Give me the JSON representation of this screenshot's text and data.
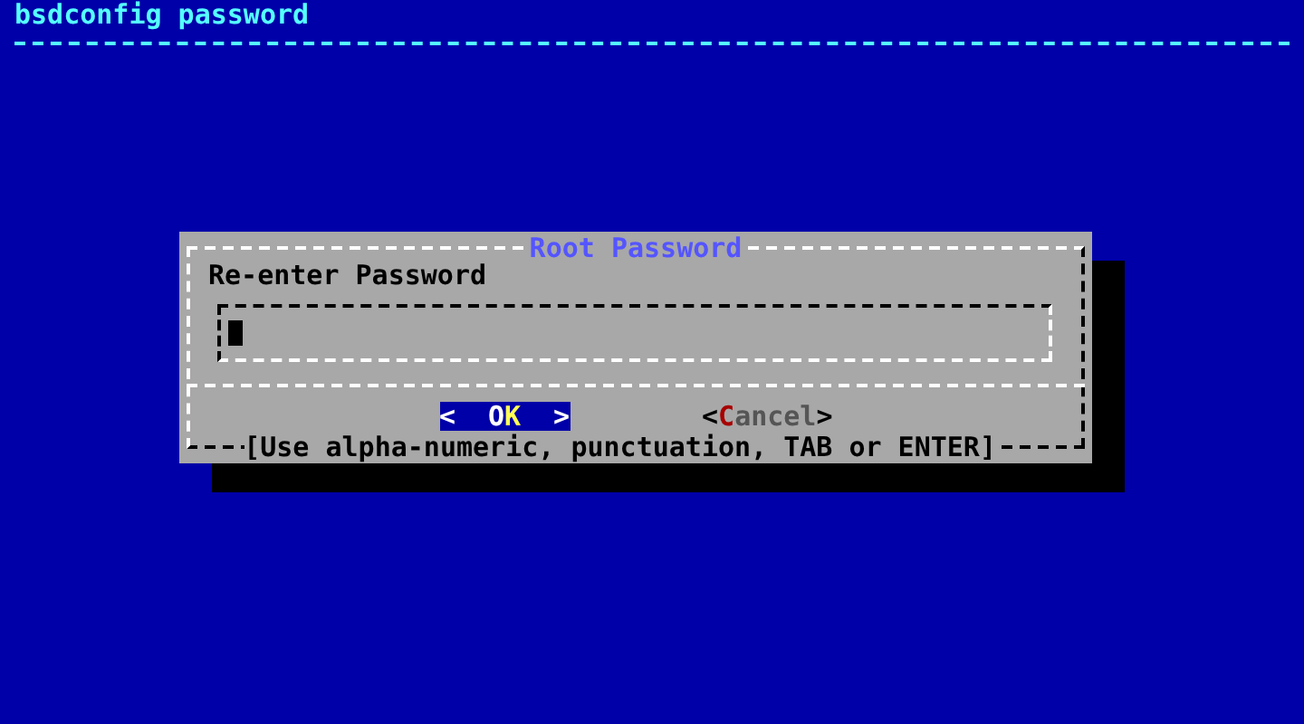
{
  "screen_title": "bsdconfig password",
  "dialog": {
    "title": "Root Password",
    "prompt": "Re-enter Password",
    "field": {
      "focused": true
    },
    "buttons": [
      {
        "open": "<",
        "before": "O",
        "hotkey": "K",
        "close": ">",
        "selected": true
      },
      {
        "open": "<",
        "hotkey": "C",
        "after": "ancel",
        "close": ">",
        "selected": false
      }
    ],
    "hint": "[Use alpha-numeric, punctuation, TAB or ENTER]"
  }
}
